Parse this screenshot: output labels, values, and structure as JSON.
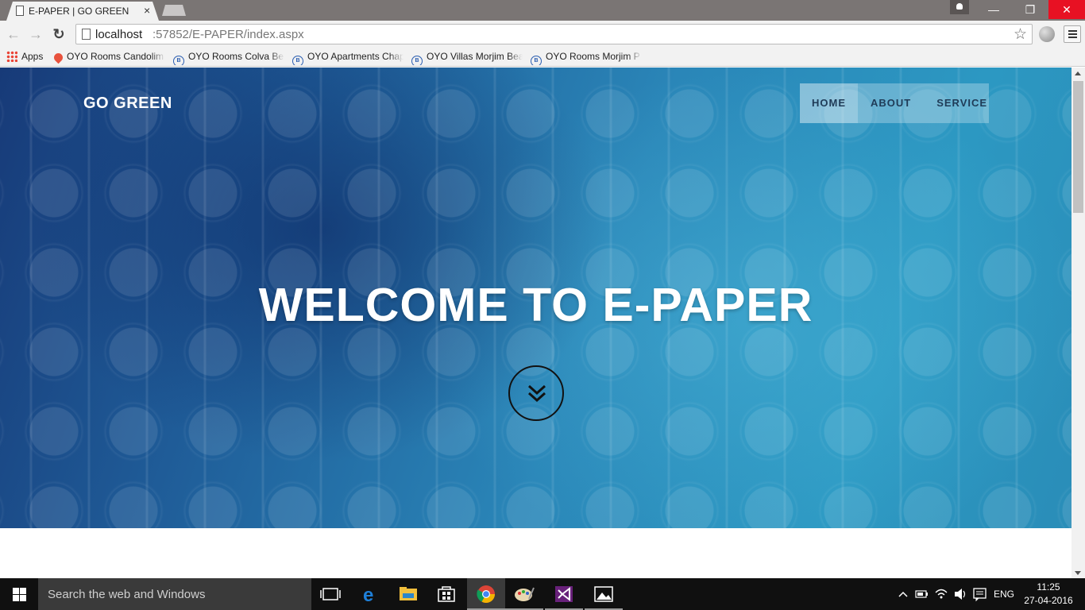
{
  "browser": {
    "tab_title": "E-PAPER | GO GREEN",
    "tab_close": "×",
    "window_controls": {
      "minimize": "—",
      "maximize": "❐",
      "close": "✕"
    },
    "url_host": "localhost",
    "url_path": ":57852/E-PAPER/index.aspx",
    "bookmarks": [
      {
        "label": "Apps",
        "icon": "apps-grid-icon"
      },
      {
        "label": "OYO Rooms Candolim",
        "icon": "map-pin-icon"
      },
      {
        "label": "OYO Rooms Colva Bea",
        "icon": "booking-icon"
      },
      {
        "label": "OYO Apartments Chap",
        "icon": "booking-icon"
      },
      {
        "label": "OYO Villas Morjim Bea",
        "icon": "booking-icon"
      },
      {
        "label": "OYO Rooms Morjim P",
        "icon": "booking-icon"
      }
    ]
  },
  "page": {
    "brand": "GO GREEN",
    "nav": [
      {
        "label": "HOME",
        "active": true
      },
      {
        "label": "ABOUT",
        "active": false
      },
      {
        "label": "SERVICE",
        "active": false
      }
    ],
    "hero_title": "WELCOME TO E-PAPER",
    "scroll_icon": "double-chevron-down-icon"
  },
  "taskbar": {
    "search_placeholder": "Search the web and Windows",
    "apps": [
      "task-view-icon",
      "edge-icon",
      "file-explorer-icon",
      "store-icon",
      "chrome-icon",
      "paint-icon",
      "visual-studio-icon",
      "photos-icon"
    ],
    "active_app": "chrome-icon",
    "language": "ENG",
    "time": "11:25",
    "date": "27-04-2016"
  },
  "colors": {
    "hero_dark": "#173a78",
    "hero_light": "#2c98c2",
    "taskbar": "#101010",
    "close_red": "#e81123"
  }
}
